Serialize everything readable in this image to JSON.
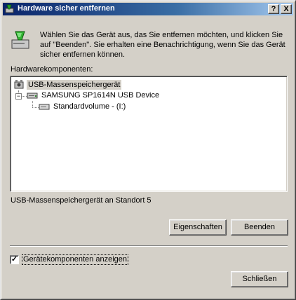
{
  "window": {
    "title": "Hardware sicher entfernen",
    "help_label": "?",
    "close_label": "X",
    "icon": "hardware-icon"
  },
  "info": {
    "text": "Wählen Sie das Gerät aus, das Sie entfernen möchten, und klicken Sie auf \"Beenden\". Sie erhalten eine Benachrichtigung, wenn Sie das Gerät sicher entfernen können.",
    "icon": "safely-remove-hardware-icon"
  },
  "hardware_label": "Hardwarekomponenten:",
  "tree": {
    "items": [
      {
        "label": "USB-Massenspeichergerät",
        "icon": "usb-icon",
        "selected": true
      },
      {
        "label": "SAMSUNG SP1614N USB Device",
        "icon": "disk-drive-icon",
        "expanded": true
      },
      {
        "label": "Standardvolume - (I:)",
        "icon": "volume-icon"
      }
    ]
  },
  "location_text": "USB-Massenspeichergerät an Standort 5",
  "buttons": {
    "properties": "Eigenschaften",
    "stop": "Beenden",
    "close": "Schließen"
  },
  "show_components": {
    "label": "Gerätekomponenten anzeigen",
    "checked": true
  },
  "colors": {
    "title_start": "#0a246a",
    "title_end": "#a6caf0",
    "face": "#d4d0c8"
  }
}
